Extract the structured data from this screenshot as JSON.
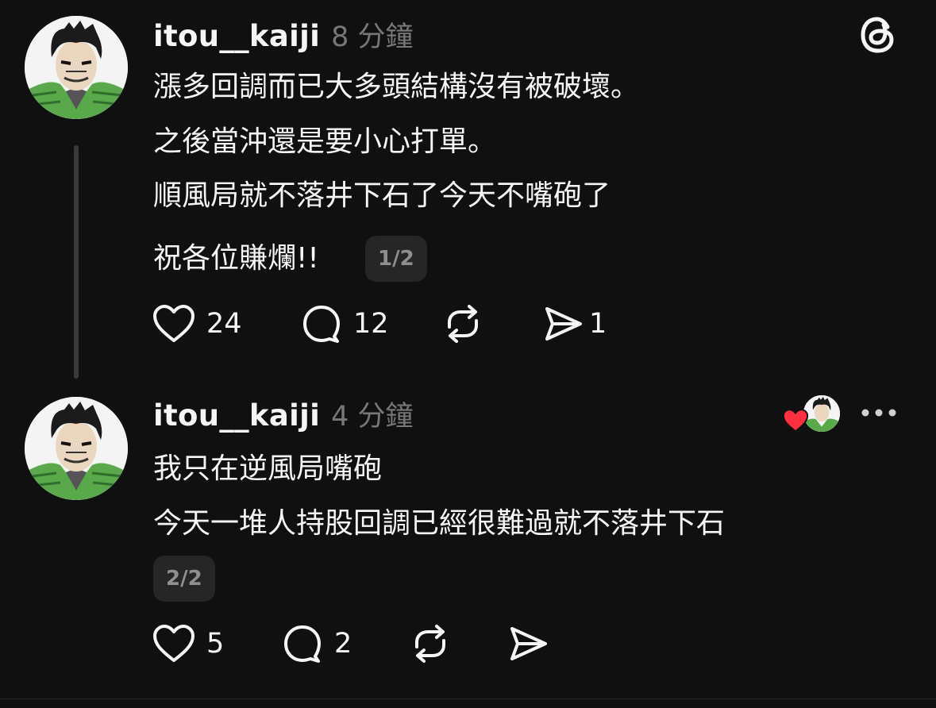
{
  "posts": [
    {
      "username": "itou__kaiji",
      "time": "8 分鐘",
      "lines": [
        "漲多回調而已大多頭結構沒有被破壞。",
        "之後當沖還是要小心打單。",
        "順風局就不落井下石了今天不嘴砲了",
        "祝各位賺爛!!"
      ],
      "page_indicator": "1/2",
      "likes": "24",
      "replies": "12",
      "shares": "1"
    },
    {
      "username": "itou__kaiji",
      "time": "4 分鐘",
      "lines": [
        "我只在逆風局嘴砲",
        "今天一堆人持股回調已經很難過就不落井下石"
      ],
      "page_indicator": "2/2",
      "likes": "5",
      "replies": "2"
    }
  ],
  "icons": {
    "threads_logo": "threads-logo-icon",
    "like": "heart-icon",
    "reply": "comment-icon",
    "repost": "repost-icon",
    "share": "send-icon",
    "more": "more-dots-icon",
    "liked_badge": "red-heart-icon"
  },
  "colors": {
    "background": "#101010",
    "text": "#f3f5f7",
    "secondary": "#777777",
    "liked_heart": "#ff3040"
  }
}
